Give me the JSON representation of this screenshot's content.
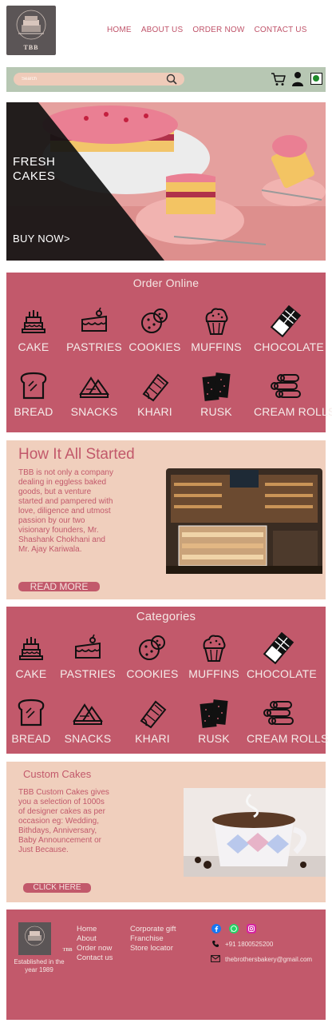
{
  "brand": {
    "name": "TBB"
  },
  "nav": [
    "HOME",
    "ABOUT US",
    "ORDER NOW",
    "CONTACT US"
  ],
  "search": {
    "placeholder": "Search"
  },
  "colors": {
    "accent": "#c2596b",
    "peach": "#f0cfbd",
    "sage": "#b7c7b3",
    "charcoal": "#5b5556"
  },
  "hero": {
    "title_line1": "FRESH",
    "title_line2": "CAKES",
    "cta": "BUY NOW>"
  },
  "order_online": {
    "title": "Order Online",
    "items": [
      {
        "label": "CAKE",
        "icon": "cake-icon"
      },
      {
        "label": "PASTRIES",
        "icon": "pastry-icon"
      },
      {
        "label": "COOKIES",
        "icon": "cookies-icon"
      },
      {
        "label": "MUFFINS",
        "icon": "muffin-icon"
      },
      {
        "label": "CHOCOLATE",
        "icon": "chocolate-icon"
      },
      {
        "label": "BREAD",
        "icon": "bread-icon"
      },
      {
        "label": "SNACKS",
        "icon": "snacks-icon"
      },
      {
        "label": "KHARI",
        "icon": "khari-icon"
      },
      {
        "label": "RUSK",
        "icon": "rusk-icon"
      },
      {
        "label": "CREAM ROLLS",
        "icon": "cream-rolls-icon"
      }
    ]
  },
  "about": {
    "title": "How It All Started",
    "body": "TBB is not only a company dealing in eggless baked goods, but a venture started and pampered with love, diligence and utmost passion by our two visionary founders, Mr. Shashank Chokhani and Mr. Ajay Kariwala.",
    "cta": "READ MORE"
  },
  "categories": {
    "title": "Categories",
    "items": [
      {
        "label": "CAKE",
        "icon": "cake-icon"
      },
      {
        "label": "PASTRIES",
        "icon": "pastry-icon"
      },
      {
        "label": "COOKIES",
        "icon": "cookies-icon"
      },
      {
        "label": "MUFFINS",
        "icon": "muffin-icon"
      },
      {
        "label": "CHOCOLATE",
        "icon": "chocolate-icon"
      },
      {
        "label": "BREAD",
        "icon": "bread-icon"
      },
      {
        "label": "SNACKS",
        "icon": "snacks-icon"
      },
      {
        "label": "KHARI",
        "icon": "khari-icon"
      },
      {
        "label": "RUSK",
        "icon": "rusk-icon"
      },
      {
        "label": "CREAM ROLLS",
        "icon": "cream-rolls-icon"
      }
    ]
  },
  "custom": {
    "title": "Custom Cakes",
    "body": "TBB Custom Cakes gives you a selection of 1000s of designer cakes as per occasion eg: Wedding, Bithdays, Anniversary, Baby Announcement or Just Because.",
    "cta": "CLICK HERE"
  },
  "footer": {
    "established": "Established in the year 1989",
    "links_col1": [
      "Home",
      "About",
      "Order now",
      "Contact us"
    ],
    "links_col2": [
      "Corporate gift",
      "Franchise",
      "Store locator"
    ],
    "phone": "+91 1800525200",
    "email": "thebrothersbakery@gmail.com",
    "social": [
      "facebook-icon",
      "whatsapp-icon",
      "instagram-icon"
    ]
  }
}
